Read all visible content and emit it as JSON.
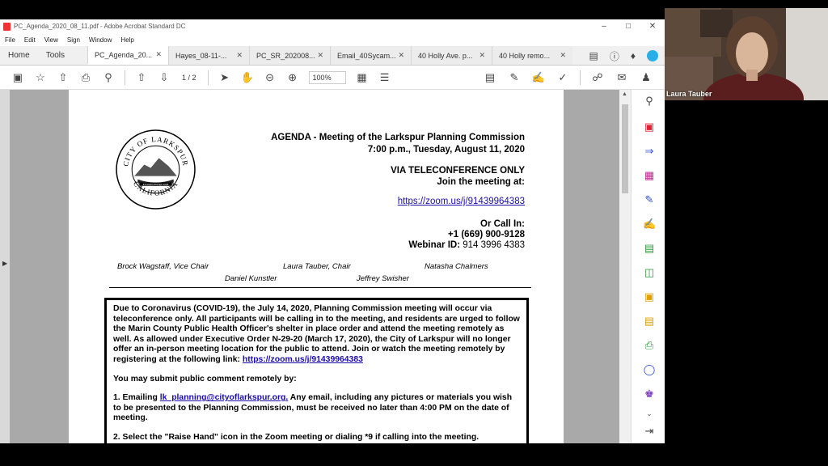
{
  "window": {
    "title": "PC_Agenda_2020_08_11.pdf - Adobe Acrobat Standard DC",
    "menu": [
      "File",
      "Edit",
      "View",
      "Sign",
      "Window",
      "Help"
    ]
  },
  "tabs": {
    "home": "Home",
    "tools": "Tools",
    "documents": [
      "PC_Agenda_20...",
      "Hayes_08-11-...",
      "PC_SR_202008...",
      "Email_40Sycam...",
      "40 Holly Ave. p...",
      "40 Holly remo..."
    ]
  },
  "toolbar": {
    "page_current": "1",
    "page_total": "/ 2",
    "zoom": "100%"
  },
  "document": {
    "seal": {
      "top": "CITY OF LARKSPUR",
      "bottom": "CALIFORNIA",
      "band": "INCORPORATED 1908"
    },
    "heading1": "AGENDA - Meeting of the Larkspur Planning Commission",
    "heading2": "7:00 p.m., Tuesday, August 11, 2020",
    "teleconf": "VIA TELECONFERENCE ONLY",
    "join": "Join the meeting at:",
    "zoom_link": "https://zoom.us/j/91439964383",
    "call_in": "Or Call In:",
    "phone": "+1 (669) 900-9128",
    "webinar_label": "Webinar ID:",
    "webinar_id": "914 3996 4383",
    "members": [
      "Brock Wagstaff, Vice Chair",
      "Laura Tauber, Chair",
      "Natasha Chalmers",
      "Daniel Kunstler",
      "Jeffrey Swisher"
    ],
    "notice_p1": "Due to Coronavirus (COVID-19), the July 14, 2020, Planning Commission meeting will occur via teleconference only. All participants will be calling in to the meeting, and residents are urged to follow the Marin County Public Health Officer's shelter in place order and attend the meeting remotely as well.  As allowed under Executive Order N-29-20 (March 17, 2020), the City of Larkspur will no longer offer an in-person meeting location for the public to attend. Join or watch the meeting remotely by registering at the following link: ",
    "notice_link": "https://zoom.us/j/91439964383",
    "notice_p2": "You may submit public comment remotely by:",
    "notice_p3_a": "1.  Emailing ",
    "notice_email": "lk_planning@cityoflarkspur.org.",
    "notice_p3_b": "  Any email, including any pictures or materials you wish to be presented to the Planning Commission, must be received no later than 4:00 PM on the date of meeting.",
    "notice_p4": "2.  Select the \"Raise Hand\" icon in the Zoom meeting or dialing *9 if calling into the meeting."
  },
  "video": {
    "participant": "Laura Tauber"
  },
  "colors": {
    "link": "#1a0dab",
    "accent": "#27b0e8",
    "sidebar_icon": "#c0278f"
  }
}
